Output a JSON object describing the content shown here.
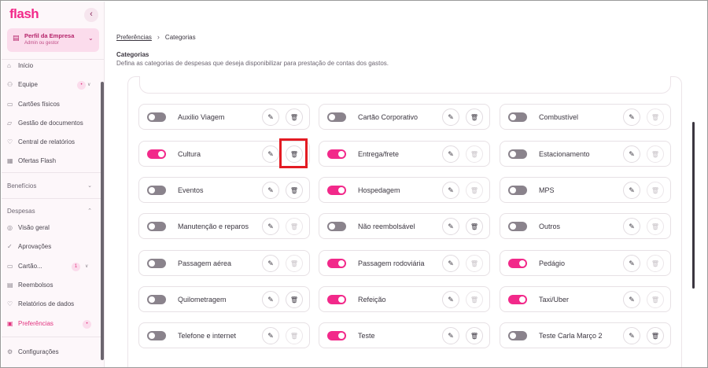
{
  "sidebar": {
    "logo": "flash",
    "collapse_icon": "chevron-left-icon",
    "profile": {
      "title": "Perfil da Empresa",
      "subtitle": "Admin ou gestor"
    },
    "items": [
      {
        "label": "Início",
        "icon": "home-icon"
      },
      {
        "label": "Equipe",
        "icon": "users-icon",
        "badge": "•"
      },
      {
        "label": "Cartões físicos",
        "icon": "card-icon"
      },
      {
        "label": "Gestão de documentos",
        "icon": "folder-icon"
      },
      {
        "label": "Central de relatórios",
        "icon": "chart-icon"
      },
      {
        "label": "Ofertas Flash",
        "icon": "gift-icon"
      }
    ],
    "section_beneficios": "Benefícios",
    "section_despesas": "Despesas",
    "despesas_items": [
      {
        "label": "Visão geral",
        "icon": "eye-icon"
      },
      {
        "label": "Aprovações",
        "icon": "check-icon"
      },
      {
        "label": "Cartão...",
        "icon": "card-icon",
        "badge": "1"
      },
      {
        "label": "Reembolsos",
        "icon": "receipt-icon"
      },
      {
        "label": "Relatórios de dados",
        "icon": "report-icon"
      },
      {
        "label": "Preferências",
        "icon": "settings-icon",
        "badge": "•"
      }
    ],
    "settings": {
      "label": "Configurações",
      "icon": "gear-icon"
    }
  },
  "breadcrumb": {
    "parent": "Preferências",
    "current": "Categorias"
  },
  "page": {
    "title": "Categorias",
    "description": "Defina as categorias de despesas que deseja disponibilizar para prestação de contas dos gastos."
  },
  "categories": [
    {
      "label": "Auxilio Viagem",
      "on": false,
      "delete_enabled": true
    },
    {
      "label": "Cartão Corporativo",
      "on": false,
      "delete_enabled": true
    },
    {
      "label": "Combustível",
      "on": false,
      "delete_enabled": false
    },
    {
      "label": "Cultura",
      "on": true,
      "delete_enabled": true
    },
    {
      "label": "Entrega/frete",
      "on": true,
      "delete_enabled": false
    },
    {
      "label": "Estacionamento",
      "on": false,
      "delete_enabled": false
    },
    {
      "label": "Eventos",
      "on": false,
      "delete_enabled": true
    },
    {
      "label": "Hospedagem",
      "on": true,
      "delete_enabled": false
    },
    {
      "label": "MPS",
      "on": false,
      "delete_enabled": false
    },
    {
      "label": "Manutenção e reparos",
      "on": false,
      "delete_enabled": false
    },
    {
      "label": "Não reembolsável",
      "on": false,
      "delete_enabled": true
    },
    {
      "label": "Outros",
      "on": false,
      "delete_enabled": false
    },
    {
      "label": "Passagem aérea",
      "on": false,
      "delete_enabled": false
    },
    {
      "label": "Passagem rodoviária",
      "on": true,
      "delete_enabled": false
    },
    {
      "label": "Pedágio",
      "on": true,
      "delete_enabled": false
    },
    {
      "label": "Quilometragem",
      "on": false,
      "delete_enabled": true
    },
    {
      "label": "Refeição",
      "on": true,
      "delete_enabled": false
    },
    {
      "label": "Taxi/Uber",
      "on": true,
      "delete_enabled": false
    },
    {
      "label": "Telefone e internet",
      "on": false,
      "delete_enabled": false
    },
    {
      "label": "Teste",
      "on": true,
      "delete_enabled": true
    },
    {
      "label": "Teste Carla Março 2",
      "on": false,
      "delete_enabled": true
    }
  ],
  "colors": {
    "accent": "#f2298a",
    "toggle_off": "#8a838c",
    "highlight": "#e31b23"
  }
}
